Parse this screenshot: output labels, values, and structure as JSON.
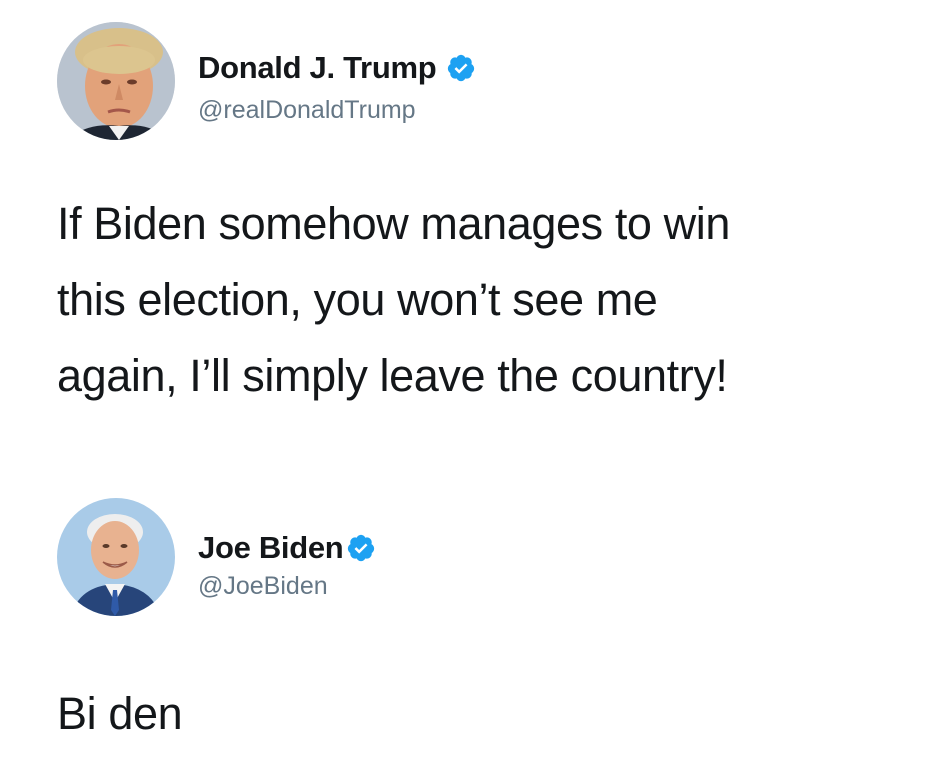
{
  "tweets": [
    {
      "display_name": "Donald J. Trump",
      "handle": "@realDonaldTrump",
      "verified": true,
      "avatar_icon": "avatar-photo-icon",
      "text_lines": [
        "If Biden somehow manages to win",
        "this election, you won’t see me",
        "again, I’ll simply leave the country!"
      ]
    },
    {
      "display_name": "Joe Biden",
      "handle": "@JoeBiden",
      "verified": true,
      "avatar_icon": "avatar-photo-icon",
      "text_lines": [
        "Bi den"
      ]
    }
  ],
  "colors": {
    "background": "#ffffff",
    "text": "#14171a",
    "handle": "#657786",
    "verified_badge": "#1da1f2"
  }
}
